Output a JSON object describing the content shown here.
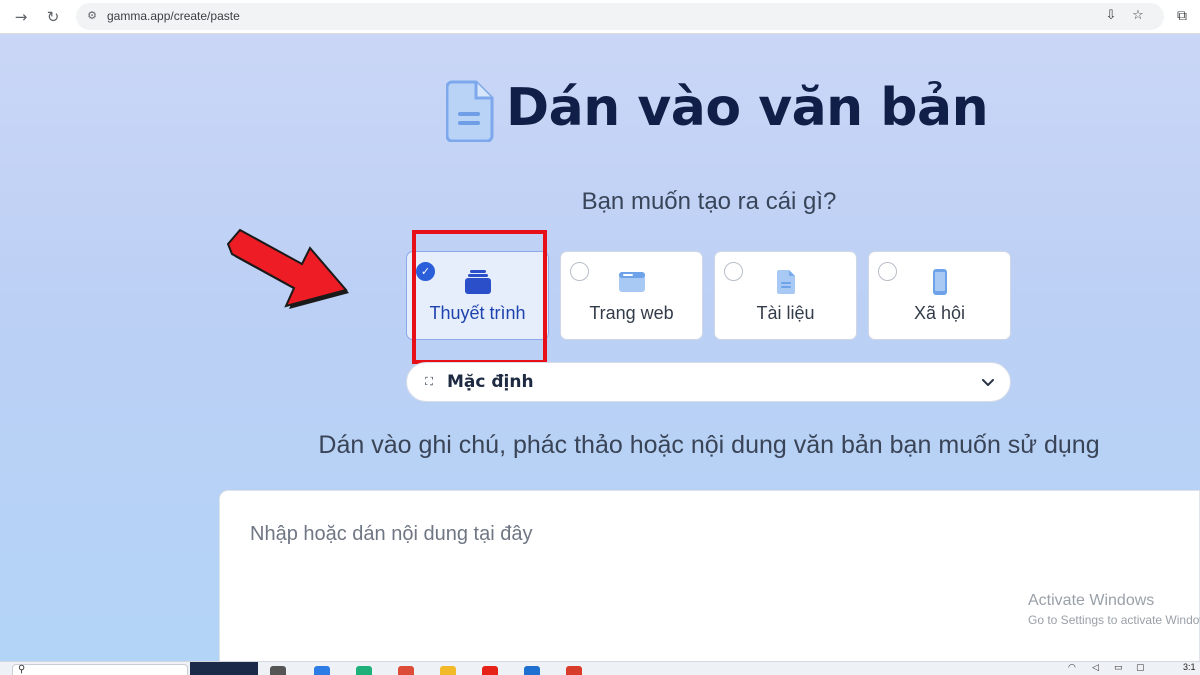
{
  "browser": {
    "url": "gamma.app/create/paste"
  },
  "page": {
    "title": "Dán vào văn bản",
    "question": "Bạn muốn tạo ra cái gì?",
    "types": [
      {
        "label": "Thuyết trình",
        "selected": true
      },
      {
        "label": "Trang web",
        "selected": false
      },
      {
        "label": "Tài liệu",
        "selected": false
      },
      {
        "label": "Xã hội",
        "selected": false
      }
    ],
    "dropdown": {
      "label": "Mặc định"
    },
    "instruction": "Dán vào ghi chú, phác thảo hoặc nội dung văn bản bạn muốn sử dụng",
    "textarea_placeholder": "Nhập hoặc dán nội dung tại đây"
  },
  "watermark": {
    "title": "Activate Windows",
    "subtitle": "Go to Settings to activate Windows."
  },
  "taskbar": {
    "clock": "3:1"
  },
  "colors": {
    "accent": "#2b5ed9",
    "highlight_red": "#e81018",
    "title": "#0f1f47"
  }
}
